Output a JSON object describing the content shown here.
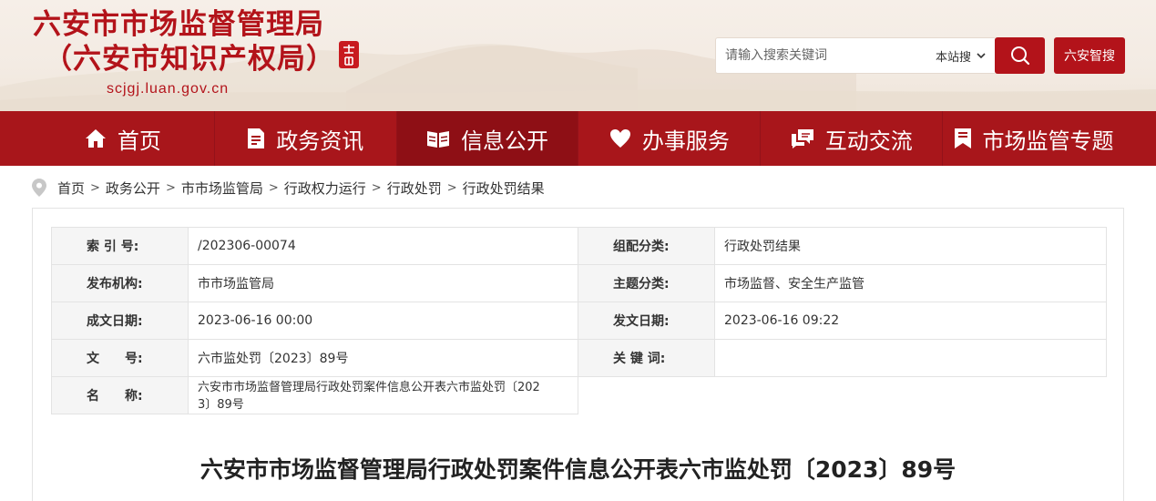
{
  "header": {
    "title_line1": "六安市市场监督管理局",
    "title_line2": "（六安市知识产权局）",
    "domain": "scjgj.luan.gov.cn",
    "seal_text": "六安",
    "brand_color": "#b3131a",
    "search": {
      "placeholder": "请输入搜索关键词",
      "scope": "本站搜",
      "smart_search_label": "六安智搜"
    }
  },
  "nav": {
    "items": [
      {
        "label": "首页",
        "icon": "home-icon"
      },
      {
        "label": "政务资讯",
        "icon": "document-icon"
      },
      {
        "label": "信息公开",
        "icon": "open-book-icon",
        "active": true
      },
      {
        "label": "办事服务",
        "icon": "heart-icon"
      },
      {
        "label": "互动交流",
        "icon": "chat-icon"
      },
      {
        "label": "市场监管专题",
        "icon": "bookmark-icon"
      }
    ],
    "background": "#a8161b",
    "active_background": "#8e0f15"
  },
  "breadcrumb": [
    "首页",
    "政务公开",
    "市市场监管局",
    "行政权力运行",
    "行政处罚",
    "行政处罚结果"
  ],
  "meta": {
    "index_label": "索 引 号:",
    "index_value": "/202306-00074",
    "category_label": "组配分类:",
    "category_value": "行政处罚结果",
    "publisher_label": "发布机构:",
    "publisher_value": "市市场监管局",
    "topic_label": "主题分类:",
    "topic_value": "市场监督、安全生产监管",
    "created_label": "成文日期:",
    "created_value": "2023-06-16 00:00",
    "published_label": "发文日期:",
    "published_value": "2023-06-16 09:22",
    "docno_label": "文　　号:",
    "docno_value": "六市监处罚〔2023〕89号",
    "keywords_label": "关 键 词:",
    "keywords_value": "",
    "name_label": "名　　称:",
    "name_value_line1": "六安市市场监督管理局行政处罚案件信息公开表六市监处罚〔202",
    "name_value_line2": "3〕89号"
  },
  "article": {
    "title": "六安市市场监督管理局行政处罚案件信息公开表六市监处罚〔2023〕89号"
  }
}
